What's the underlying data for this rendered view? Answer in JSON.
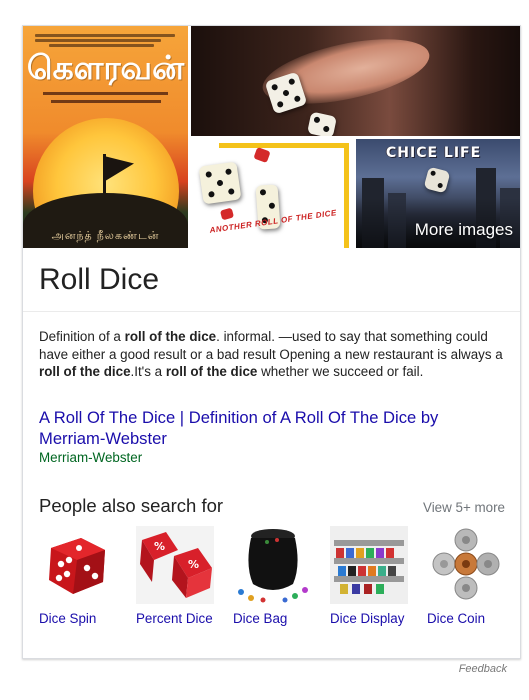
{
  "images": {
    "cover_title": "கௌரவன்",
    "cover_author": "அனந்த் நீலகண்டன்",
    "chice_logo": "CHICE LIFE",
    "book2_caption": "ANOTHER ROLL OF THE DICE",
    "more_images_label": "More images"
  },
  "entity": {
    "title": "Roll Dice"
  },
  "definition": {
    "parts": [
      {
        "text": "Definition of a ",
        "bold": false
      },
      {
        "text": "roll of the dice",
        "bold": true
      },
      {
        "text": ". informal. —used to say that something could have either a good result or a bad result Opening a new restaurant is always a ",
        "bold": false
      },
      {
        "text": "roll of the dice",
        "bold": true
      },
      {
        "text": ".It's a ",
        "bold": false
      },
      {
        "text": "roll of the dice",
        "bold": true
      },
      {
        "text": " whether we succeed or fail.",
        "bold": false
      }
    ]
  },
  "result": {
    "link_text": "A Roll Of The Dice | Definition of A Roll Of The Dice by Merriam-Webster",
    "source": "Merriam-Webster"
  },
  "people_also_search": {
    "heading": "People also search for",
    "view_more": "View 5+ more",
    "items": [
      {
        "label": "Dice Spin",
        "icon": "red-dice-icon"
      },
      {
        "label": "Percent Dice",
        "icon": "percent-dice-icon"
      },
      {
        "label": "Dice Bag",
        "icon": "dice-bag-icon"
      },
      {
        "label": "Dice Display",
        "icon": "dice-display-icon"
      },
      {
        "label": "Dice Coin",
        "icon": "dice-coin-icon"
      }
    ]
  },
  "footer": {
    "feedback": "Feedback"
  },
  "colors": {
    "link": "#1a0dab",
    "source": "#006621",
    "muted": "#70757a",
    "border": "#dadce0"
  }
}
